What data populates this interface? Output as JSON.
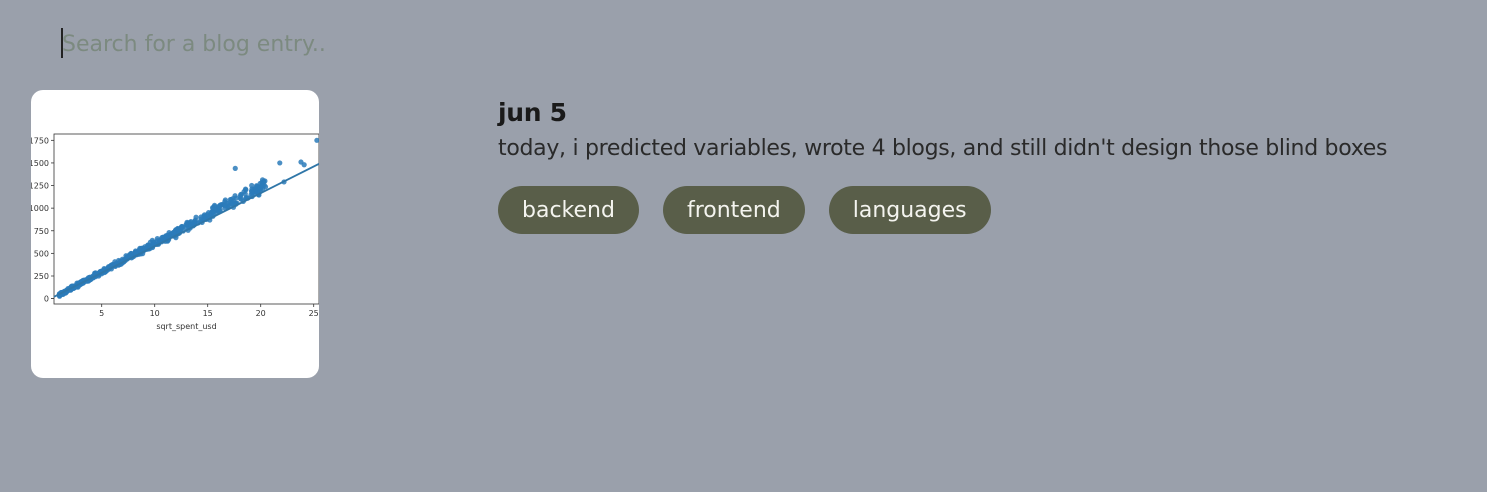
{
  "search": {
    "placeholder": "Search for a blog entry.."
  },
  "entry": {
    "date": "jun 5",
    "description": "today, i predicted variables, wrote 4 blogs, and still didn't design those blind boxes",
    "tags": [
      "backend",
      "frontend",
      "languages"
    ],
    "thumbnail": {
      "chart_data": {
        "type": "scatter",
        "xlabel": "sqrt_spent_usd",
        "ylabel": "",
        "xlim": [
          0.5,
          25.5
        ],
        "ylim": [
          -60,
          1820
        ],
        "xticks": [
          5,
          10,
          15,
          20,
          25
        ],
        "yticks": [
          0,
          250,
          500,
          750,
          1000,
          1250,
          1500,
          1750
        ],
        "trend_line": {
          "x": [
            0.5,
            25.5
          ],
          "y": [
            20,
            1490
          ]
        },
        "color": "#2b7bba"
      }
    }
  },
  "colors": {
    "background": "#9aa0ab",
    "tag_bg": "#595e49",
    "tag_text": "#f4f4ef",
    "scatter": "#2b7bba"
  }
}
